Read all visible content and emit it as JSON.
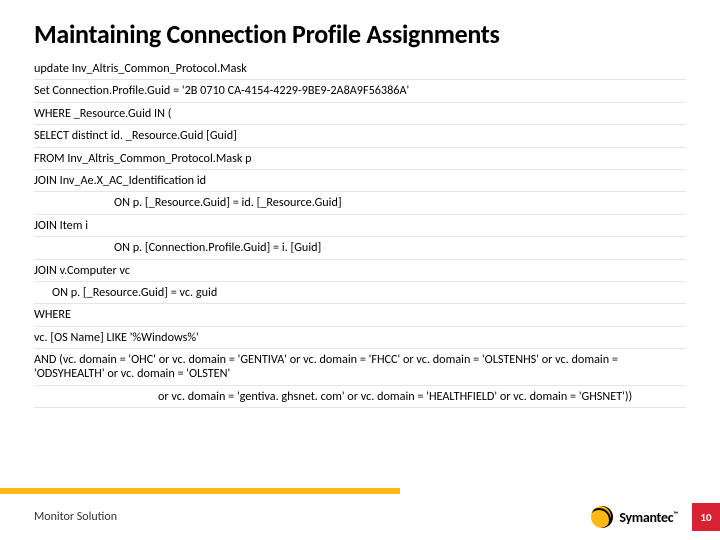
{
  "title": "Maintaining Connection Profile Assignments",
  "lines": [
    {
      "t": "update Inv_Altris_Common_Protocol.Mask",
      "cls": ""
    },
    {
      "t": "Set Connection.Profile.Guid = '2B 0710 CA-4154-4229-9BE9-2A8A9F56386A'",
      "cls": ""
    },
    {
      "t": "WHERE _Resource.Guid IN (",
      "cls": ""
    },
    {
      "t": "SELECT distinct id. _Resource.Guid [Guid]",
      "cls": ""
    },
    {
      "t": "FROM Inv_Altris_Common_Protocol.Mask p",
      "cls": ""
    },
    {
      "t": "JOIN Inv_Ae.X_AC_Identification id",
      "cls": ""
    },
    {
      "t": "ON p. [_Resource.Guid] = id. [_Resource.Guid]",
      "cls": "indent1"
    },
    {
      "t": "JOIN Item i",
      "cls": ""
    },
    {
      "t": "ON p. [Connection.Profile.Guid] = i. [Guid]",
      "cls": "indent1"
    },
    {
      "t": "JOIN v.Computer vc",
      "cls": ""
    },
    {
      "t": "ON p. [_Resource.Guid] = vc. guid",
      "cls": "indent2"
    },
    {
      "t": "WHERE",
      "cls": ""
    },
    {
      "t": "vc. [OS Name] LIKE '%Windows%'",
      "cls": ""
    },
    {
      "t": "AND (vc. domain = 'OHC' or vc. domain = 'GENTIVA' or vc. domain = 'FHCC' or vc. domain = 'OLSTENHS' or vc. domain = 'ODSYHEALTH' or vc. domain = 'OLSTEN'",
      "cls": ""
    },
    {
      "t": "or vc. domain = 'gentiva. ghsnet. com' or vc. domain = 'HEALTHFIELD' or vc. domain = 'GHSNET'))",
      "cls": "indent3"
    }
  ],
  "footer": {
    "label": "Monitor Solution",
    "brand": "Symantec",
    "page": "10"
  }
}
